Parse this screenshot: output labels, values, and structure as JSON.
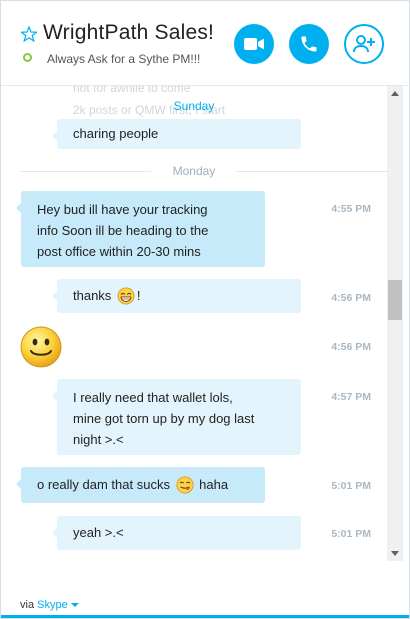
{
  "contact": {
    "name": "WrightPath Sales!",
    "mood": "Always Ask for a Sythe PM!!!"
  },
  "header_buttons": [
    "video-call",
    "voice-call",
    "add-people"
  ],
  "history": {
    "ghost_line_1": "not for awhile to come",
    "ghost_line_2": "2k posts or QMW first, I start",
    "sunday_label": "Sunday",
    "sunday_last_message": "charing people",
    "monday_label": "Monday"
  },
  "messages": [
    {
      "direction": "in",
      "lines": [
        "Hey bud ill have your tracking",
        "info Soon ill be heading to the",
        "post office within 20-30 mins"
      ],
      "time": "4:55 PM"
    },
    {
      "direction": "out",
      "before": "thanks ",
      "emoticon": "grin",
      "after": "!",
      "time": "4:56 PM"
    },
    {
      "direction": "in",
      "emoticon": "smile",
      "time": "4:56 PM"
    },
    {
      "direction": "out",
      "lines": [
        "I really need that wallet lols,",
        "mine got torn up by my dog last",
        "night >.<"
      ],
      "time": "4:57 PM"
    },
    {
      "direction": "in",
      "before": "o really dam that sucks ",
      "emoticon": "tongue",
      "after": " haha",
      "time": "5:01 PM"
    },
    {
      "direction": "out",
      "text": "yeah >.<",
      "time": "5:01 PM"
    }
  ],
  "footer": {
    "via_label": "via",
    "service": "Skype"
  },
  "colors": {
    "accent": "#00aff0",
    "incoming_bubble": "#c7eafb",
    "outgoing_bubble": "#e3f4fc",
    "timestamp": "#a9b8c3",
    "presence": "#8cc63f"
  }
}
